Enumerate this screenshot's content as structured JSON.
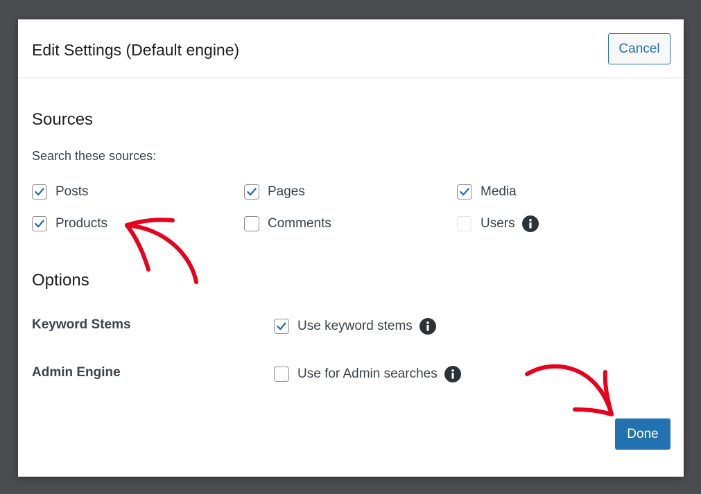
{
  "modal": {
    "title": "Edit Settings (Default engine)",
    "cancel_label": "Cancel",
    "done_label": "Done"
  },
  "sources": {
    "heading": "Sources",
    "description": "Search these sources:",
    "items": [
      {
        "label": "Posts",
        "checked": true,
        "disabled": false
      },
      {
        "label": "Pages",
        "checked": true,
        "disabled": false
      },
      {
        "label": "Media",
        "checked": true,
        "disabled": false
      },
      {
        "label": "Products",
        "checked": true,
        "disabled": false
      },
      {
        "label": "Comments",
        "checked": false,
        "disabled": false
      },
      {
        "label": "Users",
        "checked": false,
        "disabled": true,
        "has_info": true
      }
    ]
  },
  "options": {
    "heading": "Options",
    "rows": [
      {
        "label": "Keyword Stems",
        "checkbox_label": "Use keyword stems",
        "checked": true
      },
      {
        "label": "Admin Engine",
        "checkbox_label": "Use for Admin searches",
        "checked": false
      }
    ]
  },
  "colors": {
    "accent": "#2271b1",
    "annotation": "#e8001c",
    "backdrop": "#4b4c4f"
  },
  "icons": {
    "info": "info-icon",
    "check": "checkmark-icon",
    "annotation_arrow": "red-arrow-icon"
  }
}
